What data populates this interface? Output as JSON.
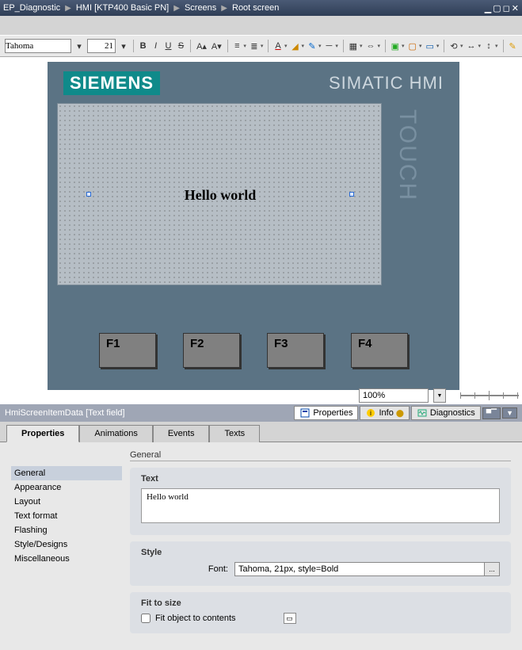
{
  "titlebar": {
    "crumbs": [
      "EP_Diagnostic",
      "HMI [KTP400 Basic PN]",
      "Screens",
      "Root screen"
    ]
  },
  "toolbar": {
    "font": "Tahoma",
    "size": "21"
  },
  "hmi": {
    "brand": "SIEMENS",
    "product": "SIMATIC HMI",
    "touch": "TOUCH",
    "text_field": "Hello world",
    "fkeys": [
      "F1",
      "F2",
      "F3",
      "F4"
    ]
  },
  "zoom": "100%",
  "inspector": {
    "title": "HmiScreenItemData [Text field]",
    "tabs": {
      "properties": "Properties",
      "info": "Info",
      "diagnostics": "Diagnostics"
    }
  },
  "prop_tabs": [
    "Properties",
    "Animations",
    "Events",
    "Texts"
  ],
  "nav": [
    "General",
    "Appearance",
    "Layout",
    "Text format",
    "Flashing",
    "Style/Designs",
    "Miscellaneous"
  ],
  "panel": {
    "heading": "General",
    "text_group": "Text",
    "text_value": "Hello world",
    "style_group": "Style",
    "font_label": "Font:",
    "font_value": "Tahoma, 21px, style=Bold",
    "fit_group": "Fit to size",
    "fit_label": "Fit object to contents"
  }
}
